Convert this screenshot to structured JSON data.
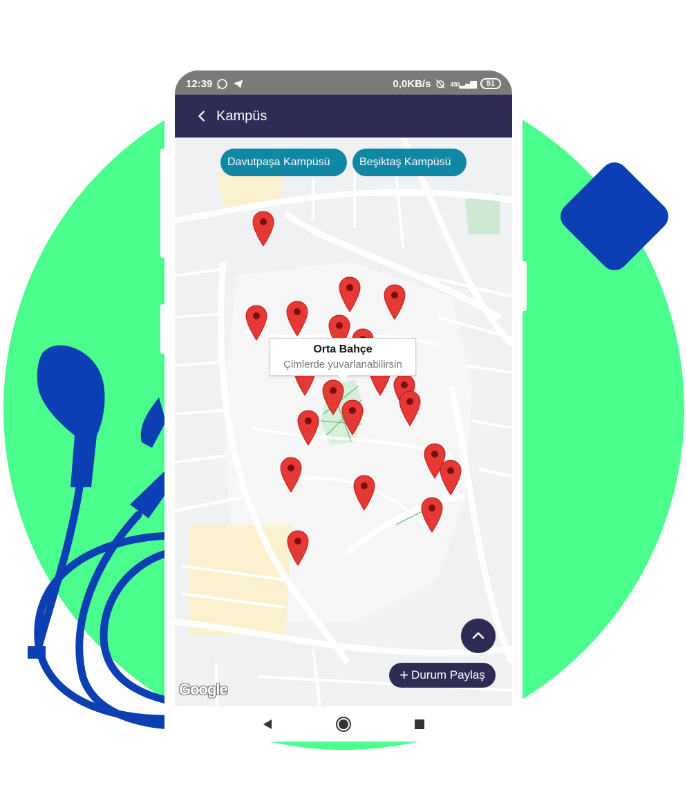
{
  "status_bar": {
    "time": "12:39",
    "network_speed": "0,0KB/s",
    "network_type": "4.5G",
    "battery": "51",
    "icons": [
      "whatsapp-icon",
      "telegram-icon",
      "alarm-off-icon",
      "signal-icon",
      "battery-icon"
    ]
  },
  "app_bar": {
    "back_icon": "chevron-left-icon",
    "title": "Kampüs",
    "color": "#2d2c54"
  },
  "map": {
    "campus_buttons": [
      {
        "label": "Davutpaşa Kampüsü"
      },
      {
        "label": "Beşiktaş Kampüsü"
      }
    ],
    "info_window": {
      "title": "Orta Bahçe",
      "subtitle": "Çimlerde yuvarlanabilirsin"
    },
    "marker_count": 20,
    "marker_color": "#e53935",
    "provider_logo": "Google"
  },
  "actions": {
    "scroll_up_icon": "chevron-up-icon",
    "share_icon": "plus-icon",
    "share_label": "Durum Paylaş"
  },
  "nav_bar": {
    "buttons": [
      "back-triangle-icon",
      "home-circle-icon",
      "recents-square-icon"
    ]
  },
  "colors": {
    "accent_green": "#4bfd8c",
    "brand_blue": "#0b3fb3",
    "chip_teal": "#0f87a5"
  }
}
